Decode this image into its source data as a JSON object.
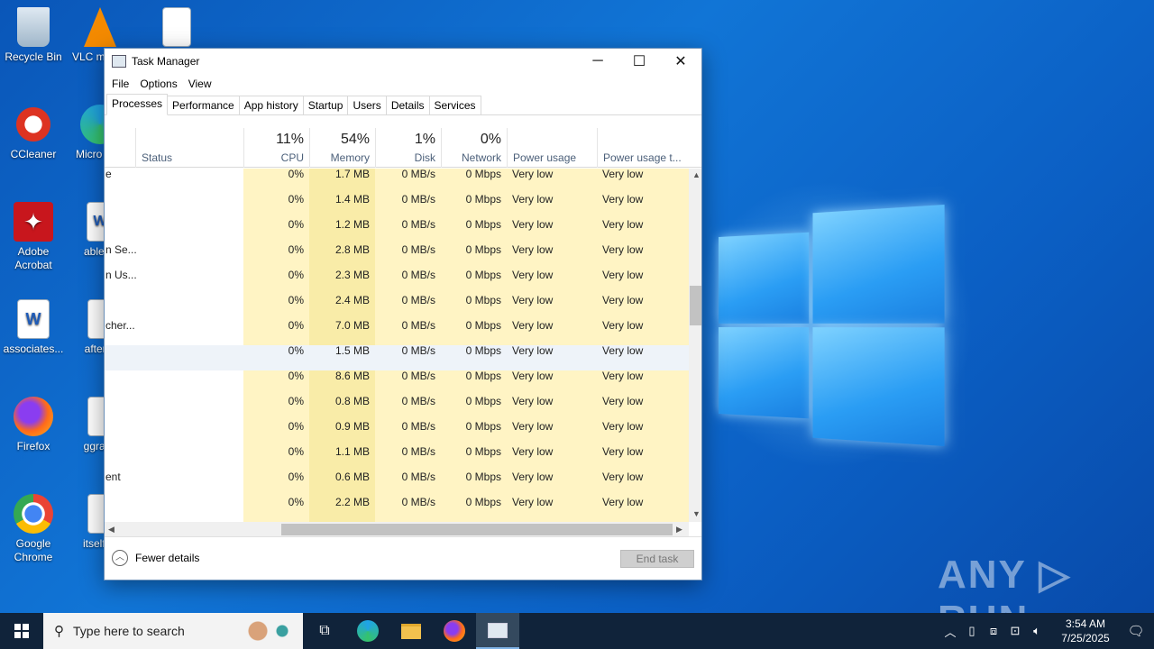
{
  "desktop": {
    "icons": [
      {
        "label": "Recycle Bin"
      },
      {
        "label": "CCleaner"
      },
      {
        "label": "Adobe Acrobat"
      },
      {
        "label": "associates..."
      },
      {
        "label": "Firefox"
      },
      {
        "label": "Google Chrome"
      },
      {
        "label": "VLC m play"
      },
      {
        "label": "Micro Edg"
      },
      {
        "label": "ablepo"
      },
      {
        "label": "afterpr"
      },
      {
        "label": "ggranc"
      },
      {
        "label": "itselfan"
      }
    ],
    "watermark": "ANY ▷ RUN"
  },
  "window": {
    "title": "Task Manager",
    "minimize": "─",
    "maximize": "☐",
    "close": "✕",
    "menu": [
      "File",
      "Options",
      "View"
    ],
    "tabs": [
      "Processes",
      "Performance",
      "App history",
      "Startup",
      "Users",
      "Details",
      "Services"
    ],
    "columns": {
      "status": "Status",
      "cpu_pct": "11%",
      "cpu": "CPU",
      "mem_pct": "54%",
      "mem": "Memory",
      "disk_pct": "1%",
      "disk": "Disk",
      "net_pct": "0%",
      "net": "Network",
      "power": "Power usage",
      "power_trend": "Power usage t..."
    },
    "rows": [
      {
        "name": "e",
        "cpu": "0%",
        "mem": "1.7 MB",
        "disk": "0 MB/s",
        "net": "0 Mbps",
        "power": "Very low",
        "trend": "Very low"
      },
      {
        "name": "",
        "cpu": "0%",
        "mem": "1.4 MB",
        "disk": "0 MB/s",
        "net": "0 Mbps",
        "power": "Very low",
        "trend": "Very low"
      },
      {
        "name": "",
        "cpu": "0%",
        "mem": "1.2 MB",
        "disk": "0 MB/s",
        "net": "0 Mbps",
        "power": "Very low",
        "trend": "Very low"
      },
      {
        "name": "n Se...",
        "cpu": "0%",
        "mem": "2.8 MB",
        "disk": "0 MB/s",
        "net": "0 Mbps",
        "power": "Very low",
        "trend": "Very low"
      },
      {
        "name": "n Us...",
        "cpu": "0%",
        "mem": "2.3 MB",
        "disk": "0 MB/s",
        "net": "0 Mbps",
        "power": "Very low",
        "trend": "Very low"
      },
      {
        "name": "",
        "cpu": "0%",
        "mem": "2.4 MB",
        "disk": "0 MB/s",
        "net": "0 Mbps",
        "power": "Very low",
        "trend": "Very low"
      },
      {
        "name": "cher...",
        "cpu": "0%",
        "mem": "7.0 MB",
        "disk": "0 MB/s",
        "net": "0 Mbps",
        "power": "Very low",
        "trend": "Very low"
      },
      {
        "name": "",
        "cpu": "0%",
        "mem": "1.5 MB",
        "disk": "0 MB/s",
        "net": "0 Mbps",
        "power": "Very low",
        "trend": "Very low"
      },
      {
        "name": "",
        "cpu": "0%",
        "mem": "8.6 MB",
        "disk": "0 MB/s",
        "net": "0 Mbps",
        "power": "Very low",
        "trend": "Very low"
      },
      {
        "name": "",
        "cpu": "0%",
        "mem": "0.8 MB",
        "disk": "0 MB/s",
        "net": "0 Mbps",
        "power": "Very low",
        "trend": "Very low"
      },
      {
        "name": "",
        "cpu": "0%",
        "mem": "0.9 MB",
        "disk": "0 MB/s",
        "net": "0 Mbps",
        "power": "Very low",
        "trend": "Very low"
      },
      {
        "name": "",
        "cpu": "0%",
        "mem": "1.1 MB",
        "disk": "0 MB/s",
        "net": "0 Mbps",
        "power": "Very low",
        "trend": "Very low"
      },
      {
        "name": "ent",
        "cpu": "0%",
        "mem": "0.6 MB",
        "disk": "0 MB/s",
        "net": "0 Mbps",
        "power": "Very low",
        "trend": "Very low"
      },
      {
        "name": "",
        "cpu": "0%",
        "mem": "2.2 MB",
        "disk": "0 MB/s",
        "net": "0 Mbps",
        "power": "Very low",
        "trend": "Very low"
      }
    ],
    "fewer_details": "Fewer details",
    "end_task": "End task"
  },
  "taskbar": {
    "search_placeholder": "Type here to search",
    "time": "3:54 AM",
    "date": "7/25/2025"
  }
}
